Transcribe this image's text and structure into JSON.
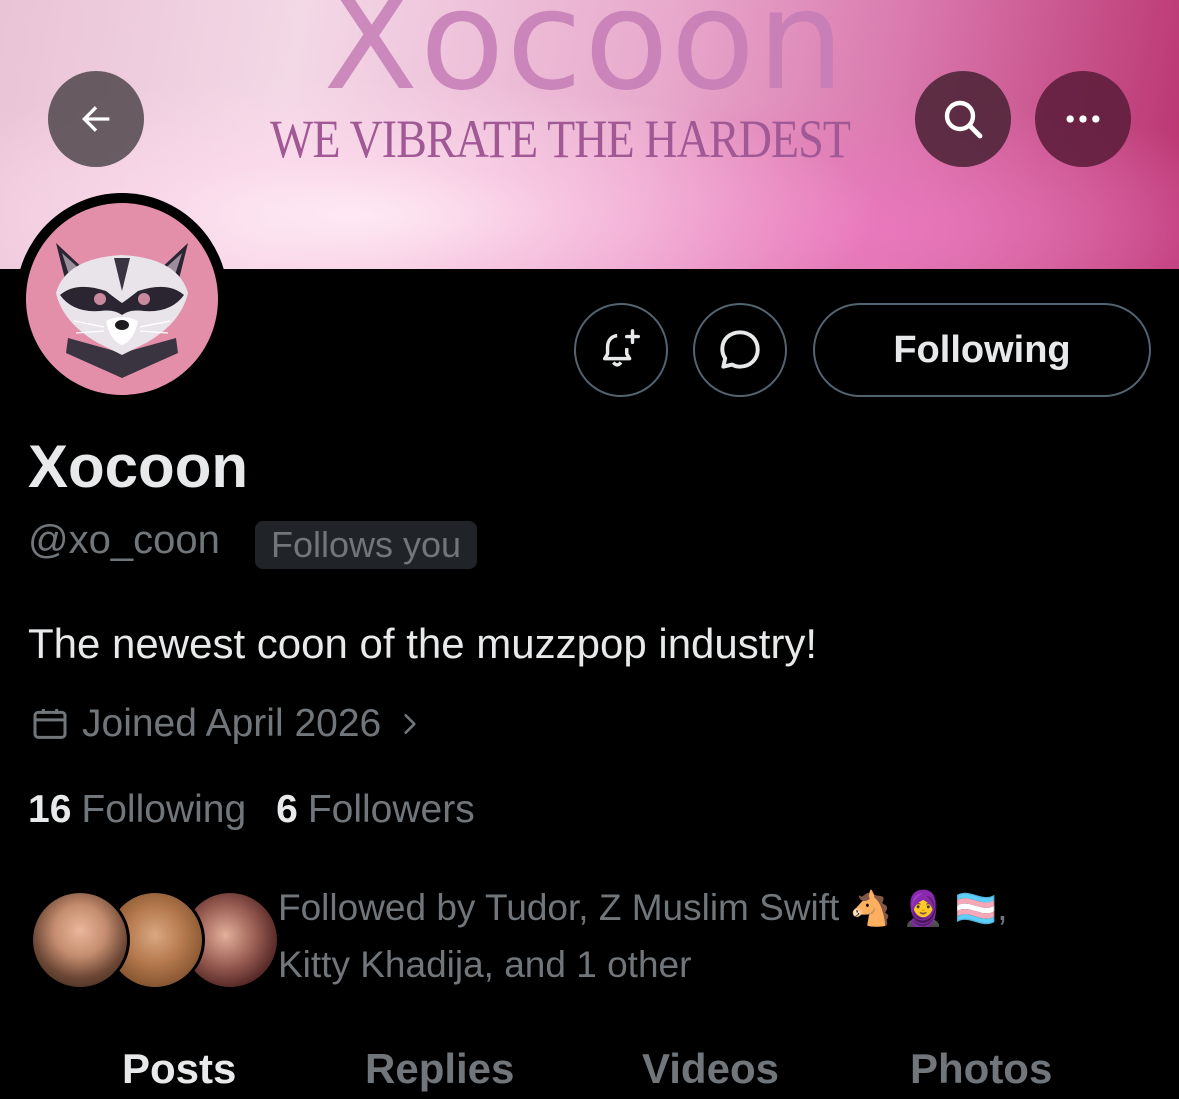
{
  "banner": {
    "title": "Xocoon",
    "tagline": "WE VIBRATE THE HARDEST"
  },
  "header": {
    "back_icon": "arrow-left-icon",
    "search_icon": "search-icon",
    "more_icon": "more-horizontal-icon"
  },
  "profile": {
    "display_name": "Xocoon",
    "handle": "@xo_coon",
    "follows_you_badge": "Follows you",
    "bio": "The newest coon of the muzzpop industry!",
    "joined": "Joined April 2026",
    "following_count": "16",
    "following_label": "Following",
    "followers_count": "6",
    "followers_label": "Followers"
  },
  "actions": {
    "notify_icon": "bell-plus-icon",
    "message_icon": "message-icon",
    "following_button": "Following"
  },
  "followed_by": {
    "line1_text": "Followed by Tudor, Z Muslim Swift",
    "emojis": [
      "🐴",
      "🧕",
      "🏳️‍⚧️"
    ],
    "line1_suffix": ",",
    "line2_text": "Kitty Khadija, and 1 other"
  },
  "tabs": [
    {
      "label": "Posts",
      "active": true
    },
    {
      "label": "Replies",
      "active": false
    },
    {
      "label": "Videos",
      "active": false
    },
    {
      "label": "Photos",
      "active": false
    }
  ],
  "colors": {
    "background": "#000000",
    "primary_text": "#e7e9ea",
    "secondary_text": "#71767b",
    "border": "#536471",
    "avatar_bg": "#e48fa9"
  }
}
